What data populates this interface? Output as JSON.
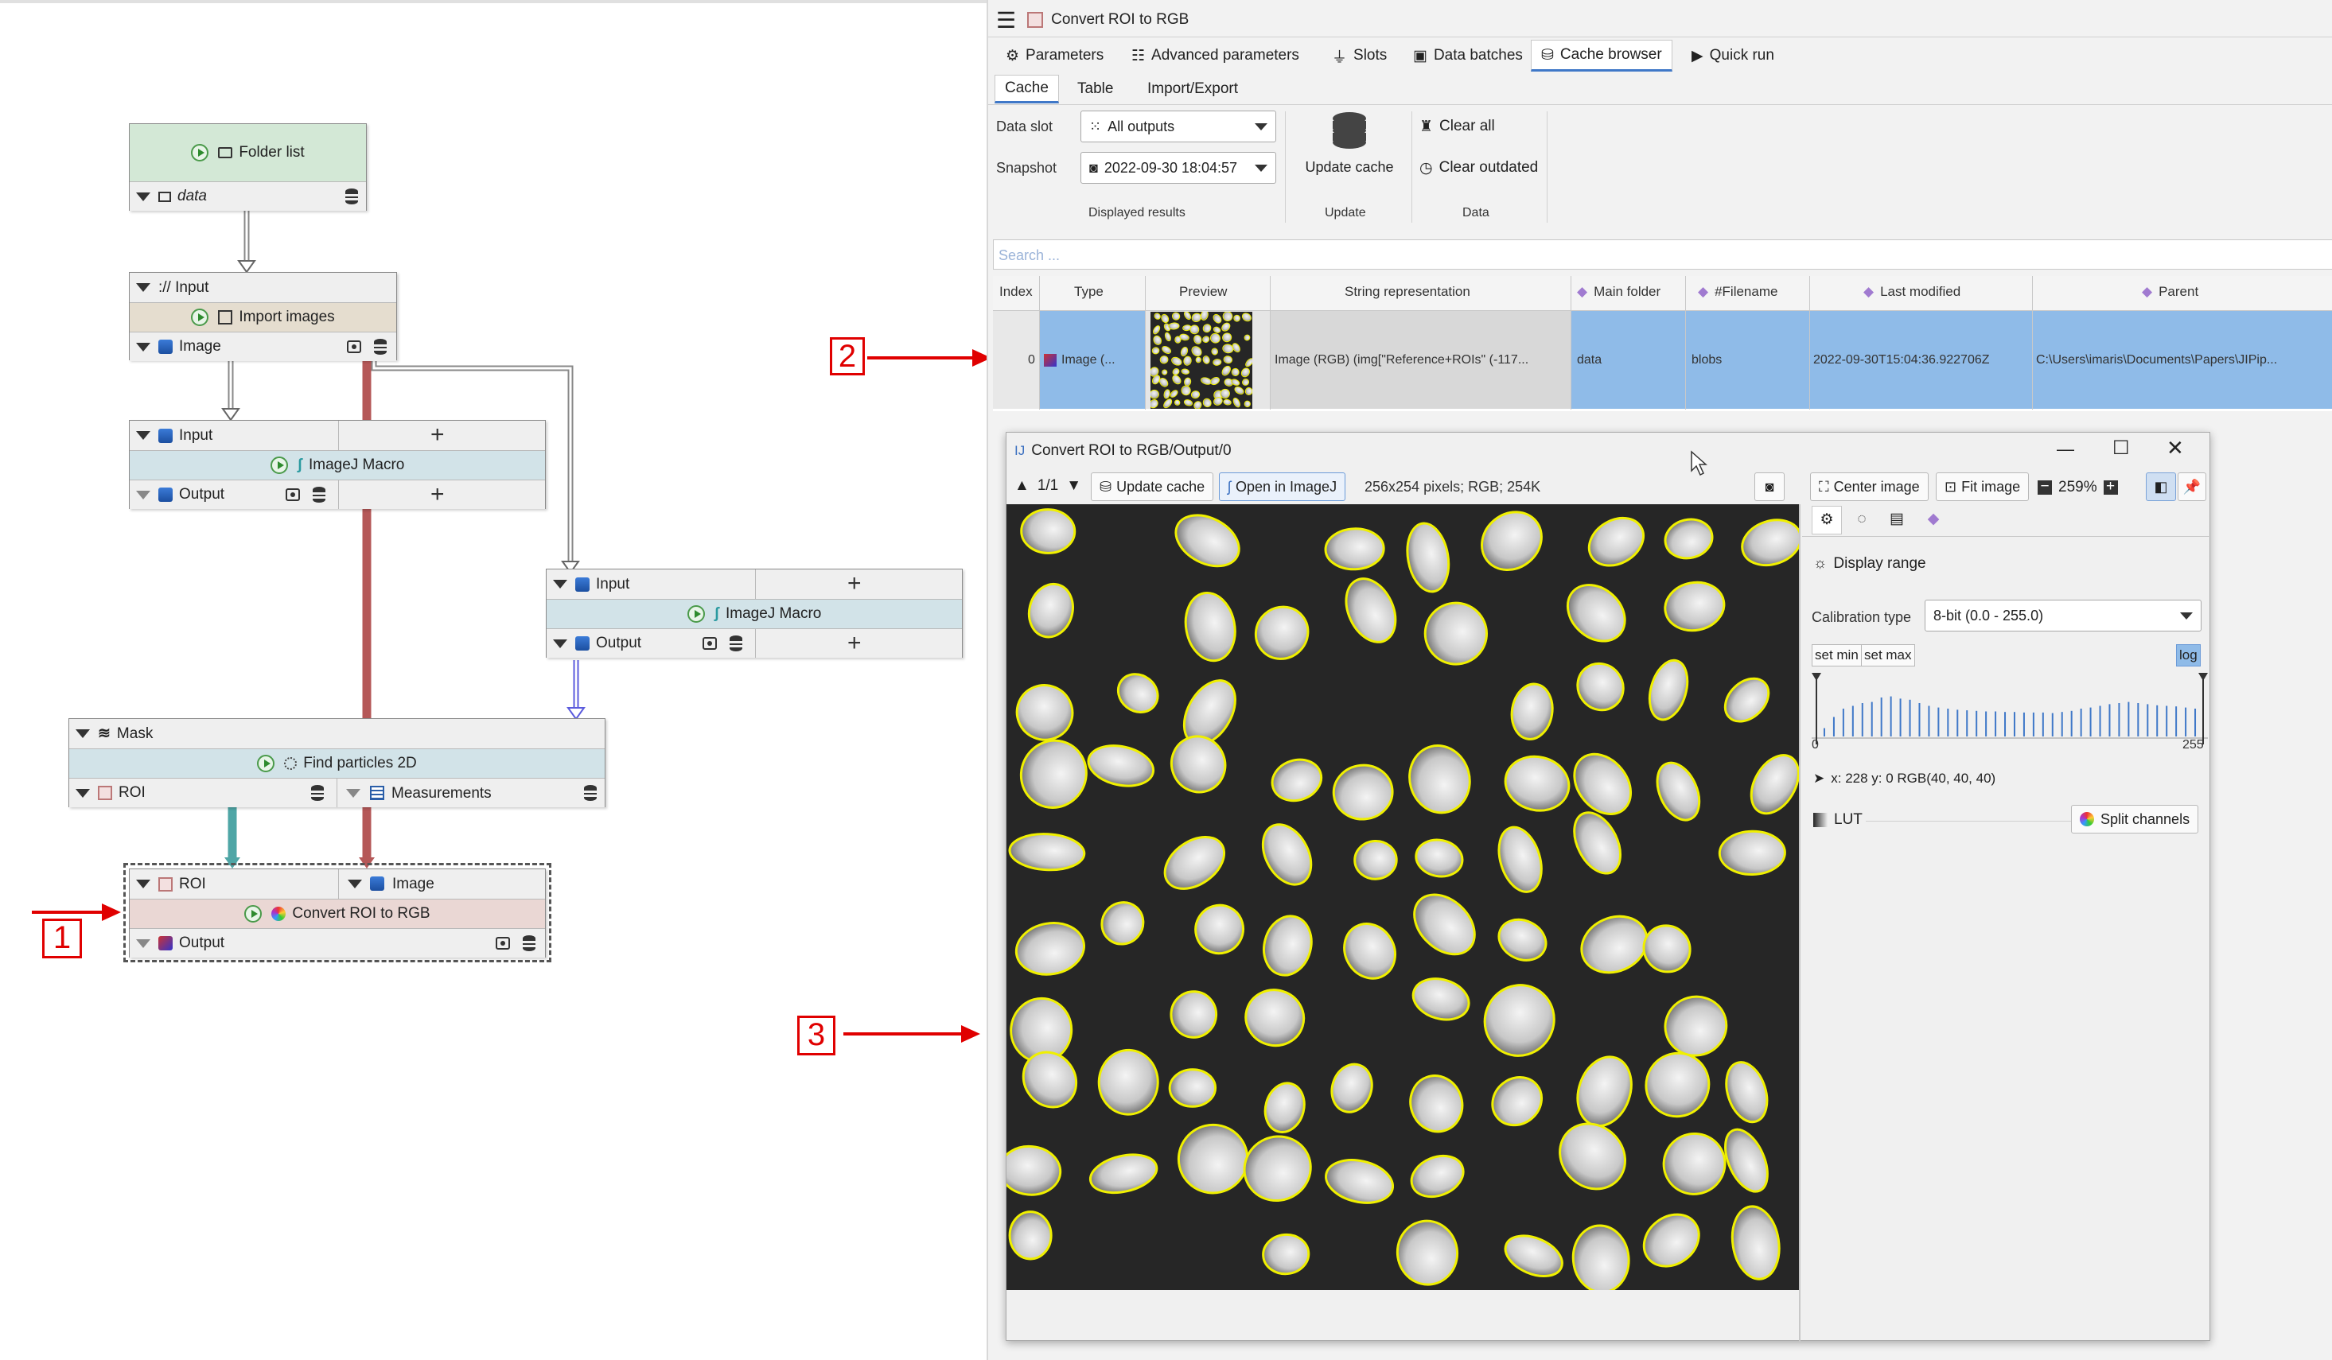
{
  "graph": {
    "folder_list": {
      "title": "Folder list",
      "output": "data"
    },
    "import_images": {
      "input": "://  Input",
      "title": "Import images",
      "output": "Image"
    },
    "macro1": {
      "input": "Input",
      "title": "ImageJ Macro",
      "output": "Output"
    },
    "macro2": {
      "input": "Input",
      "title": "ImageJ Macro",
      "output": "Output"
    },
    "find_particles": {
      "input": "Mask",
      "title": "Find particles 2D",
      "output1": "ROI",
      "output2": "Measurements"
    },
    "convert_roi": {
      "input1": "ROI",
      "input2": "Image",
      "title": "Convert ROI to RGB",
      "output": "Output"
    }
  },
  "callouts": {
    "c1": "1",
    "c2": "2",
    "c3": "3"
  },
  "panel": {
    "title": "Convert ROI to RGB",
    "tabs": [
      "Parameters",
      "Advanced parameters",
      "Slots",
      "Data batches",
      "Cache browser",
      "Quick run"
    ],
    "subtabs": [
      "Cache",
      "Table",
      "Import/Export"
    ],
    "data_slot_label": "Data slot",
    "data_slot_value": "All outputs",
    "snapshot_label": "Snapshot",
    "snapshot_value": "2022-09-30 18:04:57",
    "update_cache": "Update cache",
    "clear_all": "Clear all",
    "clear_outdated": "Clear outdated",
    "group_displayed": "Displayed results",
    "group_update": "Update",
    "group_data": "Data",
    "search_placeholder": "Search ...",
    "table": {
      "headers": [
        "Index",
        "Type",
        "Preview",
        "String representation",
        "Main folder",
        "#Filename",
        "Last modified",
        "Parent"
      ],
      "row": [
        "0",
        "Image (...",
        "",
        "Image (RGB) (img[\"Reference+ROIs\" (-117...",
        "data",
        "blobs",
        "2022-09-30T15:04:36.922706Z",
        "C:\\Users\\imaris\\Documents\\Papers\\JIPip..."
      ]
    }
  },
  "viewer": {
    "title": "Convert ROI to RGB/Output/0",
    "page": "1/1",
    "update_cache": "Update cache",
    "open_imagej": "Open in ImageJ",
    "info": "256x254 pixels; RGB; 254K",
    "center_image": "Center image",
    "fit_image": "Fit image",
    "zoom": "259%",
    "display_range": "Display range",
    "calibration_label": "Calibration type",
    "calibration_value": "8-bit (0.0 - 255.0)",
    "set_min": "set min",
    "set_max": "set max",
    "log": "log",
    "hist_min": "0",
    "hist_max": "255",
    "cursor_info": "x: 228 y: 0 RGB(40, 40, 40)",
    "lut": "LUT",
    "split_channels": "Split channels",
    "histogram": [
      0.15,
      0.35,
      0.5,
      0.55,
      0.6,
      0.62,
      0.7,
      0.72,
      0.68,
      0.66,
      0.6,
      0.55,
      0.52,
      0.5,
      0.48,
      0.47,
      0.46,
      0.45,
      0.45,
      0.44,
      0.44,
      0.43,
      0.43,
      0.43,
      0.42,
      0.44,
      0.46,
      0.5,
      0.52,
      0.55,
      0.58,
      0.6,
      0.62,
      0.6,
      0.58,
      0.56,
      0.55,
      0.54,
      0.52,
      0.5
    ]
  },
  "colors": {
    "accent": "#3f78c8",
    "roi": "#f0f000",
    "callout": "#e00000",
    "row_select": "#8fbbe8"
  }
}
